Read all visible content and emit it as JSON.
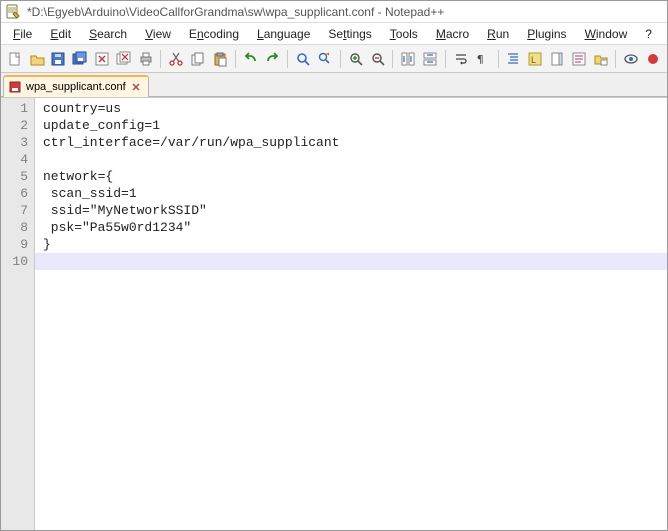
{
  "titlebar": {
    "text": "*D:\\Egyeb\\Arduino\\VideoCallforGrandma\\sw\\wpa_supplicant.conf - Notepad++"
  },
  "menu": {
    "items": [
      {
        "label": "File",
        "ul": "F"
      },
      {
        "label": "Edit",
        "ul": "E"
      },
      {
        "label": "Search",
        "ul": "S"
      },
      {
        "label": "View",
        "ul": "V"
      },
      {
        "label": "Encoding",
        "ul": "n"
      },
      {
        "label": "Language",
        "ul": "L"
      },
      {
        "label": "Settings",
        "ul": "t"
      },
      {
        "label": "Tools",
        "ul": "T"
      },
      {
        "label": "Macro",
        "ul": "M"
      },
      {
        "label": "Run",
        "ul": "R"
      },
      {
        "label": "Plugins",
        "ul": "P"
      },
      {
        "label": "Window",
        "ul": "W"
      },
      {
        "label": "?",
        "ul": "?"
      }
    ]
  },
  "toolbar": {
    "buttons": [
      {
        "name": "new-file-icon",
        "group": 0
      },
      {
        "name": "open-file-icon",
        "group": 0
      },
      {
        "name": "save-icon",
        "group": 0
      },
      {
        "name": "save-all-icon",
        "group": 0
      },
      {
        "name": "close-file-icon",
        "group": 0
      },
      {
        "name": "close-all-icon",
        "group": 0
      },
      {
        "name": "print-icon",
        "group": 0
      },
      {
        "name": "cut-icon",
        "group": 1
      },
      {
        "name": "copy-icon",
        "group": 1
      },
      {
        "name": "paste-icon",
        "group": 1
      },
      {
        "name": "undo-icon",
        "group": 2
      },
      {
        "name": "redo-icon",
        "group": 2
      },
      {
        "name": "find-icon",
        "group": 3
      },
      {
        "name": "replace-icon",
        "group": 3
      },
      {
        "name": "zoom-in-icon",
        "group": 4
      },
      {
        "name": "zoom-out-icon",
        "group": 4
      },
      {
        "name": "sync-v-icon",
        "group": 5
      },
      {
        "name": "sync-h-icon",
        "group": 5
      },
      {
        "name": "wordwrap-icon",
        "group": 6
      },
      {
        "name": "show-all-chars-icon",
        "group": 6
      },
      {
        "name": "indent-guide-icon",
        "group": 7
      },
      {
        "name": "udl-icon",
        "group": 7
      },
      {
        "name": "doc-map-icon",
        "group": 7
      },
      {
        "name": "func-list-icon",
        "group": 7
      },
      {
        "name": "folder-ws-icon",
        "group": 7
      },
      {
        "name": "monitoring-icon",
        "group": 8
      },
      {
        "name": "record-icon",
        "group": 8
      }
    ]
  },
  "tabs": {
    "items": [
      {
        "label": "wpa_supplicant.conf",
        "dirty": true,
        "active": true
      }
    ]
  },
  "editor": {
    "current_line_index": 9,
    "lines": [
      "country=us",
      "update_config=1",
      "ctrl_interface=/var/run/wpa_supplicant",
      "",
      "network={",
      " scan_ssid=1",
      " ssid=\"MyNetworkSSID\"",
      " psk=\"Pa55w0rd1234\"",
      "}",
      ""
    ]
  },
  "colors": {
    "tab_active_accent": "#f6b44a",
    "current_line_bg": "#e8e8ff",
    "dirty_indicator": "#d23b3b"
  }
}
